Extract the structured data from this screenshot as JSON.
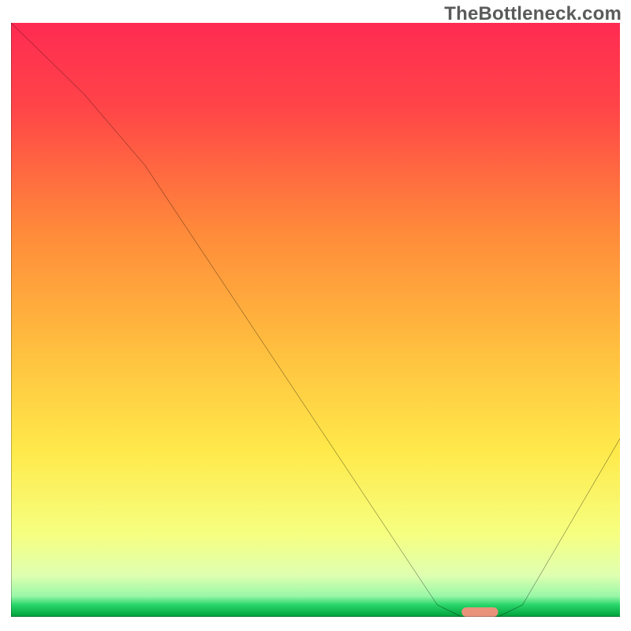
{
  "watermark": "TheBottleneck.com",
  "chart_data": {
    "type": "line",
    "title": "",
    "xlabel": "",
    "ylabel": "",
    "xlim": [
      0,
      100
    ],
    "ylim": [
      0,
      100
    ],
    "grid": false,
    "legend": false,
    "series": [
      {
        "name": "bottleneck-curve",
        "x": [
          0,
          12,
          22,
          70,
          74,
          80,
          84,
          100
        ],
        "values": [
          100,
          88,
          76,
          2,
          0,
          0,
          2,
          30
        ]
      }
    ],
    "marker": {
      "name": "optimal-range",
      "x_start": 74,
      "x_end": 80,
      "y": 0,
      "color": "#e9937b"
    },
    "background_gradient": {
      "top": "#ff2b52",
      "mid1": "#ff8a3a",
      "mid2": "#ffe94a",
      "low": "#faffb0",
      "band": "#28d66a",
      "bottom": "#009f3a"
    }
  }
}
